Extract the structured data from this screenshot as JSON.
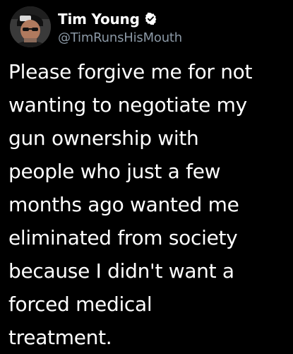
{
  "tweet": {
    "author": {
      "display_name": "Tim Young",
      "handle": "@TimRunsHisMouth",
      "verified_icon": "verified-badge-icon",
      "avatar_icon": "avatar-photo"
    },
    "text_lines": [
      "Please forgive me for not",
      "wanting to negotiate my",
      "gun ownership with",
      "people who just a few",
      "months ago wanted me",
      "eliminated from society",
      "because I didn't want a",
      "forced medical",
      "treatment."
    ]
  },
  "colors": {
    "background": "#000000",
    "text": "#ffffff",
    "handle": "#8b98a5",
    "verified": "#ffffff"
  }
}
